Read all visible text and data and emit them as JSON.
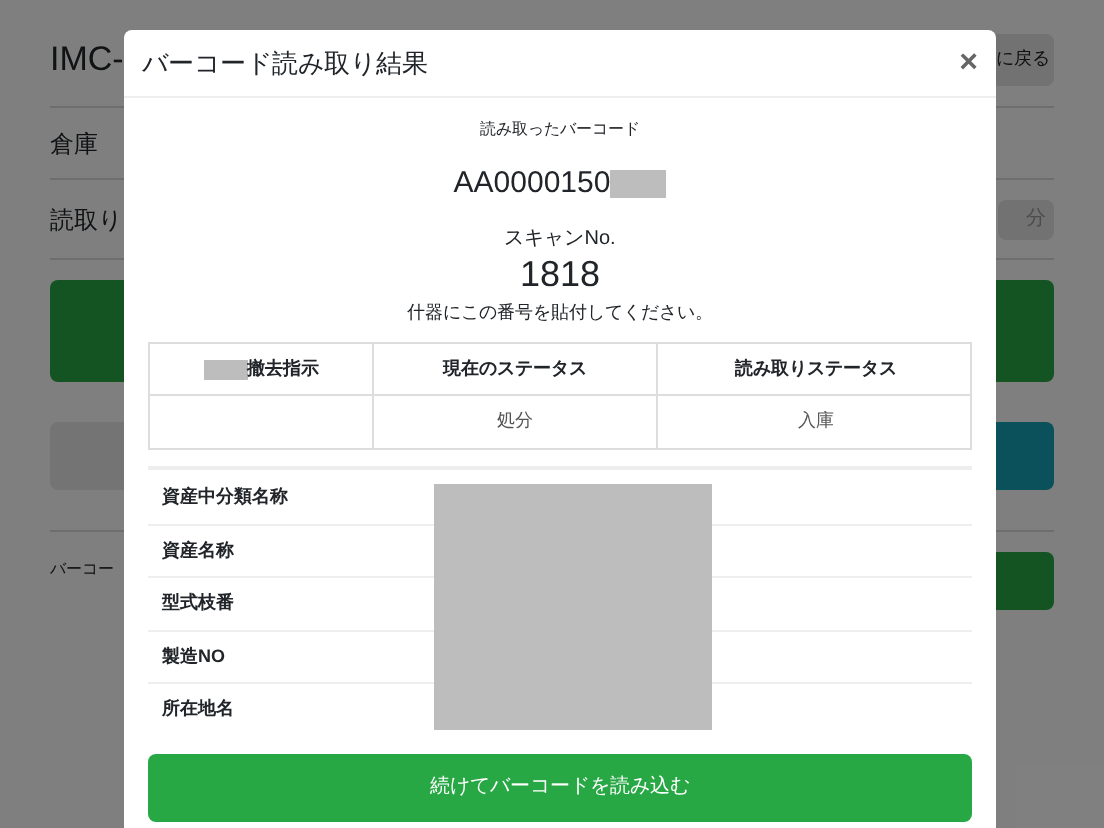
{
  "background_page": {
    "title": "IMC-",
    "back_button": "に戻る",
    "warehouse_label": "倉庫",
    "read_label": "読取り",
    "status_button": "分",
    "barcode_label": "バーコー"
  },
  "dialog": {
    "title": "バーコード読み取り結果",
    "close": "×",
    "barcode_caption": "読み取ったバーコード",
    "barcode": "AA0000150",
    "scan_caption": "スキャンNo.",
    "scan_number": "1818",
    "instruction": "什器にこの番号を貼付してください。",
    "status_table": {
      "columns": [
        "撤去指示",
        "現在のステータス",
        "読み取りステータス"
      ],
      "rows": [
        [
          "",
          "処分",
          "入庫"
        ]
      ]
    },
    "details": [
      {
        "label": "資産中分類名称"
      },
      {
        "label": "資産名称"
      },
      {
        "label": "型式枝番"
      },
      {
        "label": "製造NO"
      },
      {
        "label": "所在地名"
      }
    ],
    "continue_button": "続けてバーコードを読み込む"
  }
}
